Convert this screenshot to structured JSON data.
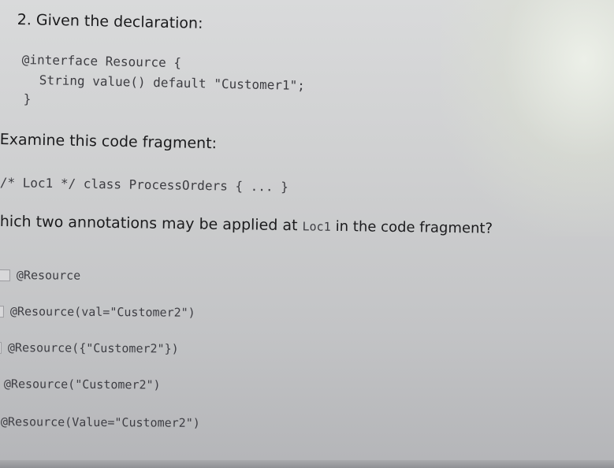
{
  "question": {
    "title": "2. Given the declaration:",
    "declaration": {
      "line1": "@interface Resource {",
      "line2": "String value() default \"Customer1\";",
      "line3": "}"
    },
    "examine": "Examine this code fragment:",
    "fragment": "/* Loc1 */ class ProcessOrders { ... }",
    "prompt_start": "hich two annotations may be applied at",
    "prompt_code": "Loc1",
    "prompt_end": "in the code fragment?"
  },
  "options": [
    {
      "label": "@Resource"
    },
    {
      "label": "@Resource(val=\"Customer2\")"
    },
    {
      "label": "@Resource({\"Customer2\"})"
    },
    {
      "label": "@Resource(\"Customer2\")"
    },
    {
      "label": "@Resource(Value=\"Customer2\")"
    }
  ]
}
